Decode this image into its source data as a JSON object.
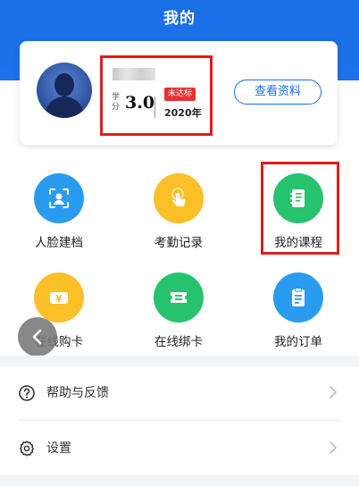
{
  "page": {
    "title": "我的"
  },
  "profile": {
    "credit_label": "学分",
    "credit_value": "3.0",
    "status": "未达标",
    "year": "2020年",
    "view_button": "查看资料"
  },
  "grid": [
    {
      "label": "人脸建档",
      "icon": "face-id-icon",
      "color": "#2a9cf0"
    },
    {
      "label": "考勤记录",
      "icon": "tap-hand-icon",
      "color": "#fbbf28"
    },
    {
      "label": "我的课程",
      "icon": "notebook-icon",
      "color": "#26c26e"
    },
    {
      "label": "在线购卡",
      "icon": "yen-card-icon",
      "color": "#fbbf28"
    },
    {
      "label": "在线绑卡",
      "icon": "ticket-icon",
      "color": "#26c26e"
    },
    {
      "label": "我的订单",
      "icon": "clipboard-icon",
      "color": "#2a9cf0"
    }
  ],
  "menu": [
    {
      "label": "帮助与反馈",
      "icon": "help-circle-icon"
    },
    {
      "label": "设置",
      "icon": "gear-icon"
    }
  ],
  "colors": {
    "accent": "#1b6fe6",
    "highlight": "#e21c1c",
    "badge": "#e8312f"
  }
}
